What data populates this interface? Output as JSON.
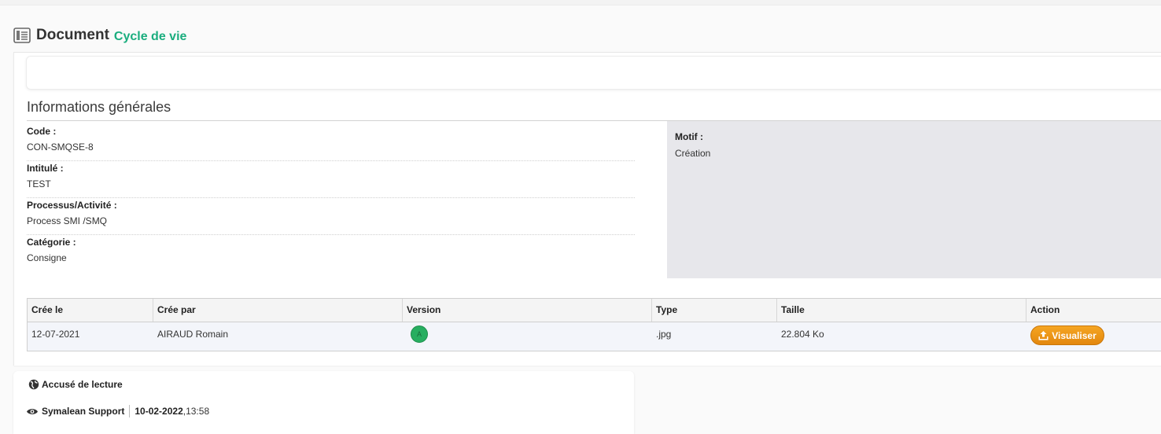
{
  "header": {
    "title": "Document",
    "subtitle": "Cycle de vie",
    "icon": "document-list-icon"
  },
  "info": {
    "section_title": "Informations générales",
    "fields": [
      {
        "label": "Code :",
        "value": "CON-SMQSE-8"
      },
      {
        "label": "Intitulé :",
        "value": "TEST"
      },
      {
        "label": "Processus/Activité :",
        "value": "Process SMI /SMQ"
      },
      {
        "label": "Catégorie :",
        "value": "Consigne"
      }
    ],
    "motif": {
      "label": "Motif :",
      "value": "Création"
    }
  },
  "versions_table": {
    "headers": [
      "Crée le",
      "Crée par",
      "Version",
      "Type",
      "Taille",
      "Action"
    ],
    "rows": [
      {
        "created_on": "12-07-2021",
        "created_by": "AIRAUD Romain",
        "version": "A",
        "type": ".jpg",
        "size": "22.804 Ko",
        "action_label": "Visualiser"
      }
    ]
  },
  "read_receipt": {
    "title": "Accusé de lecture",
    "entries": [
      {
        "name": "Symalean Support",
        "date": "10-02-2022",
        "time": ",13:58"
      }
    ]
  },
  "colors": {
    "accent_green": "#1aad7e",
    "version_badge": "#27ae60",
    "button_orange": "#f0a022",
    "motif_bg": "#e7e7eb"
  }
}
